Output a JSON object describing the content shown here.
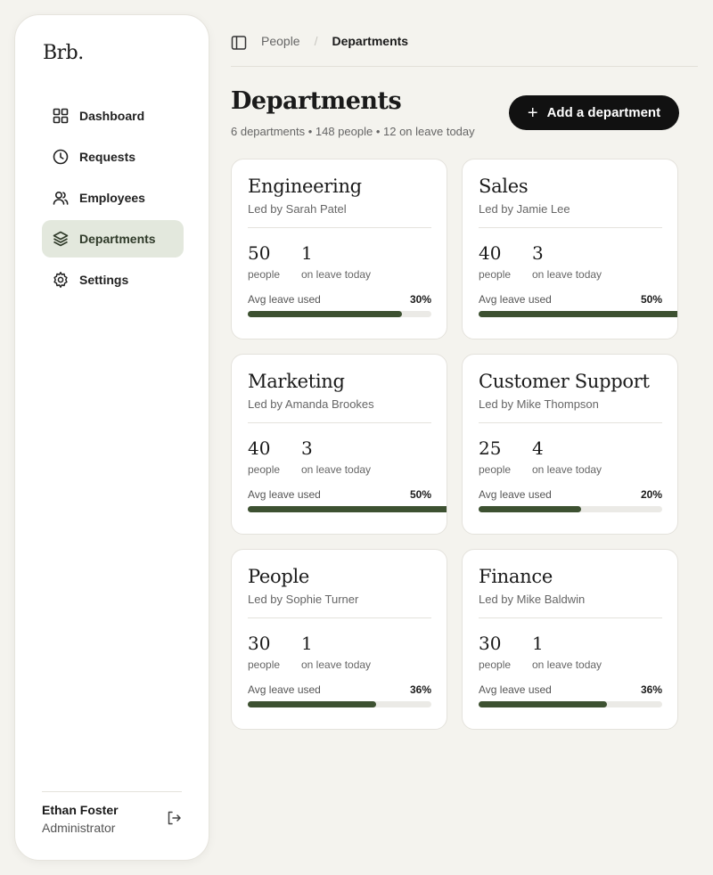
{
  "brand": {
    "logo": "Brb."
  },
  "sidebar": {
    "items": [
      {
        "label": "Dashboard",
        "icon": "grid-icon",
        "active": false
      },
      {
        "label": "Requests",
        "icon": "clock-icon",
        "active": false
      },
      {
        "label": "Employees",
        "icon": "users-icon",
        "active": false
      },
      {
        "label": "Departments",
        "icon": "layers-icon",
        "active": true
      },
      {
        "label": "Settings",
        "icon": "gear-icon",
        "active": false
      }
    ],
    "user": {
      "name": "Ethan Foster",
      "role": "Administrator"
    }
  },
  "breadcrumb": {
    "parent": "People",
    "separator": "/",
    "current": "Departments"
  },
  "header": {
    "title": "Departments",
    "subtitle": "6 departments • 148 people • 12 on leave today",
    "add_button": "Add a department"
  },
  "labels": {
    "people": "people",
    "on_leave": "on leave today",
    "avg_leave": "Avg leave used"
  },
  "departments": [
    {
      "name": "Engineering",
      "lead": "Led by Sarah Patel",
      "people": "50",
      "on_leave": "1",
      "avg_leave_label": "30%",
      "avg_leave_fill": 0.84
    },
    {
      "name": "Sales",
      "lead": "Led by Jamie Lee",
      "people": "40",
      "on_leave": "3",
      "avg_leave_label": "50%",
      "avg_leave_fill": 1.1
    },
    {
      "name": "Marketing",
      "lead": "Led by Amanda Brookes",
      "people": "40",
      "on_leave": "3",
      "avg_leave_label": "50%",
      "avg_leave_fill": 1.1
    },
    {
      "name": "Customer Support",
      "lead": "Led by Mike Thompson",
      "people": "25",
      "on_leave": "4",
      "avg_leave_label": "20%",
      "avg_leave_fill": 0.56
    },
    {
      "name": "People",
      "lead": "Led by Sophie Turner",
      "people": "30",
      "on_leave": "1",
      "avg_leave_label": "36%",
      "avg_leave_fill": 0.7
    },
    {
      "name": "Finance",
      "lead": "Led by Mike Baldwin",
      "people": "30",
      "on_leave": "1",
      "avg_leave_label": "36%",
      "avg_leave_fill": 0.7
    }
  ],
  "colors": {
    "accent": "#3d5131",
    "active_nav_bg": "#e3e8dd",
    "button_bg": "#111111",
    "page_bg": "#f4f3ee"
  }
}
